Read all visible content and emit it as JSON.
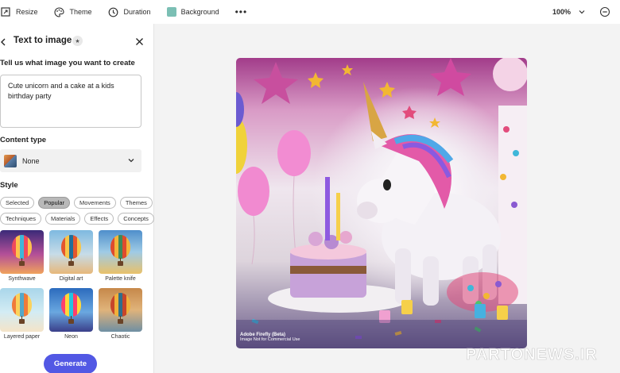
{
  "toolbar": {
    "resize_label": "Resize",
    "theme_label": "Theme",
    "duration_label": "Duration",
    "background_label": "Background",
    "more_label": "•••",
    "zoom_value": "100%",
    "background_swatch_color": "#7bbfb4"
  },
  "panel": {
    "title": "Text to image",
    "prompt_heading": "Tell us what image you want to create",
    "prompt_value": "Cute unicorn and a cake at a kids birthday party",
    "content_type_heading": "Content type",
    "content_type_value": "None",
    "style_heading": "Style",
    "style_tabs": [
      {
        "label": "Selected",
        "active": false
      },
      {
        "label": "Popular",
        "active": true
      },
      {
        "label": "Movements",
        "active": false
      },
      {
        "label": "Themes",
        "active": false
      },
      {
        "label": "Techniques",
        "active": false
      },
      {
        "label": "Materials",
        "active": false
      },
      {
        "label": "Effects",
        "active": false
      },
      {
        "label": "Concepts",
        "active": false
      }
    ],
    "styles": [
      {
        "label": "Synthwave"
      },
      {
        "label": "Digital art"
      },
      {
        "label": "Palette knife"
      },
      {
        "label": "Layered paper"
      },
      {
        "label": "Neon"
      },
      {
        "label": "Chaotic"
      }
    ],
    "generate_label": "Generate"
  },
  "canvas": {
    "watermark_title": "Adobe Firefly (Beta)",
    "watermark_subtitle": "Image Not for Commercial Use"
  },
  "site_watermark": "PARTONEWS.IR",
  "colors": {
    "accent": "#5258e4",
    "active_chip": "#b8b8b8"
  }
}
